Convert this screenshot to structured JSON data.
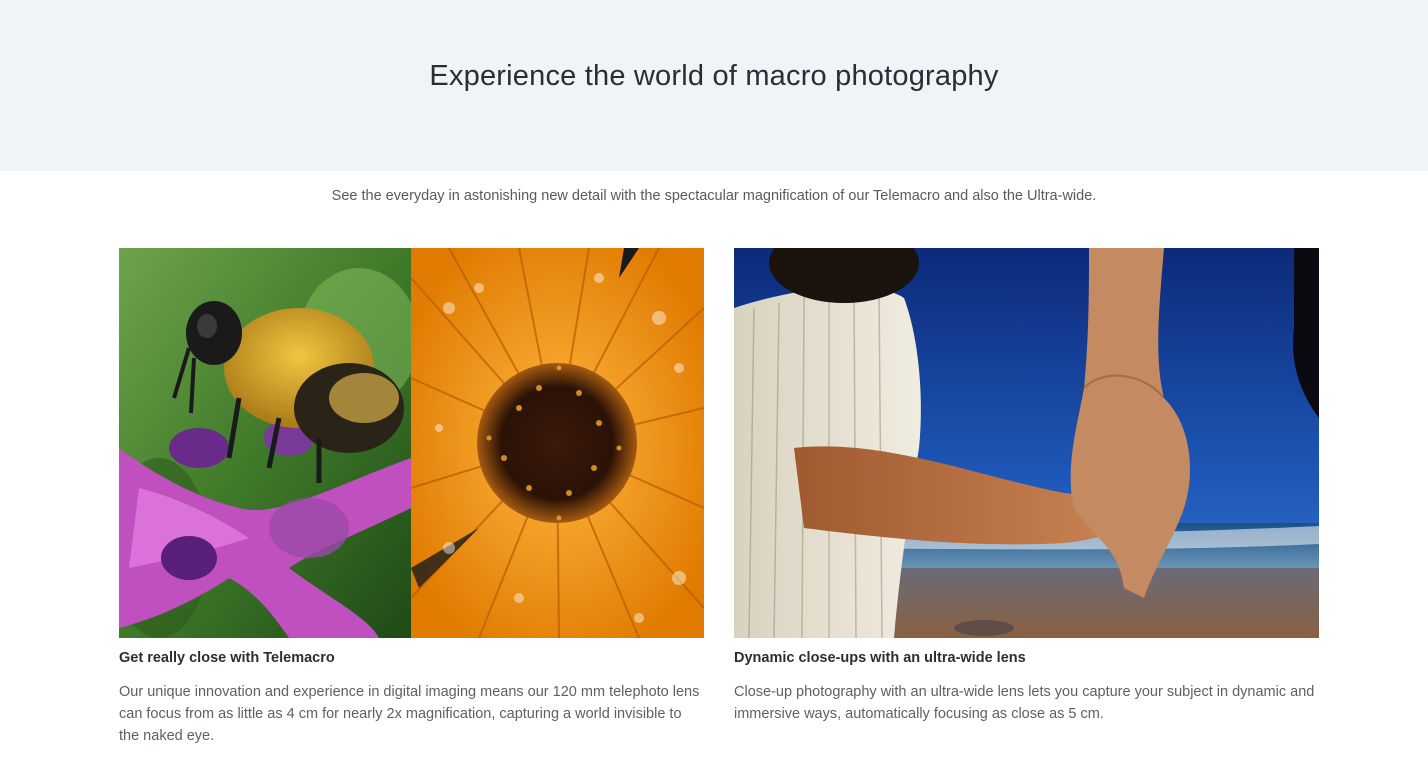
{
  "hero": {
    "title": "Experience the world of macro photography"
  },
  "intro": {
    "text": "See the everyday in astonishing new detail with the spectacular magnification of our Telemacro and also the Ultra-wide."
  },
  "cards": [
    {
      "title": "Get really close with Telemacro",
      "body": "Our unique innovation and experience in digital imaging means our 120 mm telephoto lens can focus from as little as 4 cm for nearly 2x magnification, capturing a world invisible to the naked eye.",
      "image": "bee-on-flower-and-orange-daisy-macro"
    },
    {
      "title": "Dynamic close-ups with an ultra-wide lens",
      "body": "Close-up photography with an ultra-wide lens lets you capture your subject in dynamic and immersive ways, automatically focusing as close as 5 cm.",
      "image": "child-holding-adult-hand-at-beach"
    }
  ],
  "colors": {
    "hero_bg": "#f0f3f8",
    "heading": "#2a2e33",
    "body_text": "#5b6169"
  }
}
